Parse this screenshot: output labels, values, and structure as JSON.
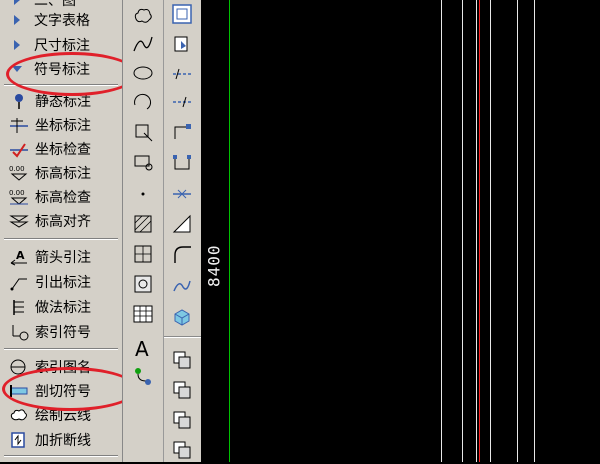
{
  "menu": {
    "top_partial": "二、图",
    "categories": [
      "文字表格",
      "尺寸标注",
      "符号标注"
    ],
    "items": [
      "静态标注",
      "坐标标注",
      "坐标检查",
      "标高标注",
      "标高检查",
      "标高对齐",
      "箭头引注",
      "引出标注",
      "做法标注",
      "索引符号",
      "索引图名",
      "剖切符号",
      "绘制云线",
      "加折断线"
    ]
  },
  "drawing": {
    "dimension_text": "8400"
  },
  "colors": {
    "highlight_circle": "#e0202a",
    "panel_bg": "#d4d0c8",
    "canvas_bg": "#000000",
    "green_line": "#00c000",
    "red_line": "#ff2020"
  }
}
